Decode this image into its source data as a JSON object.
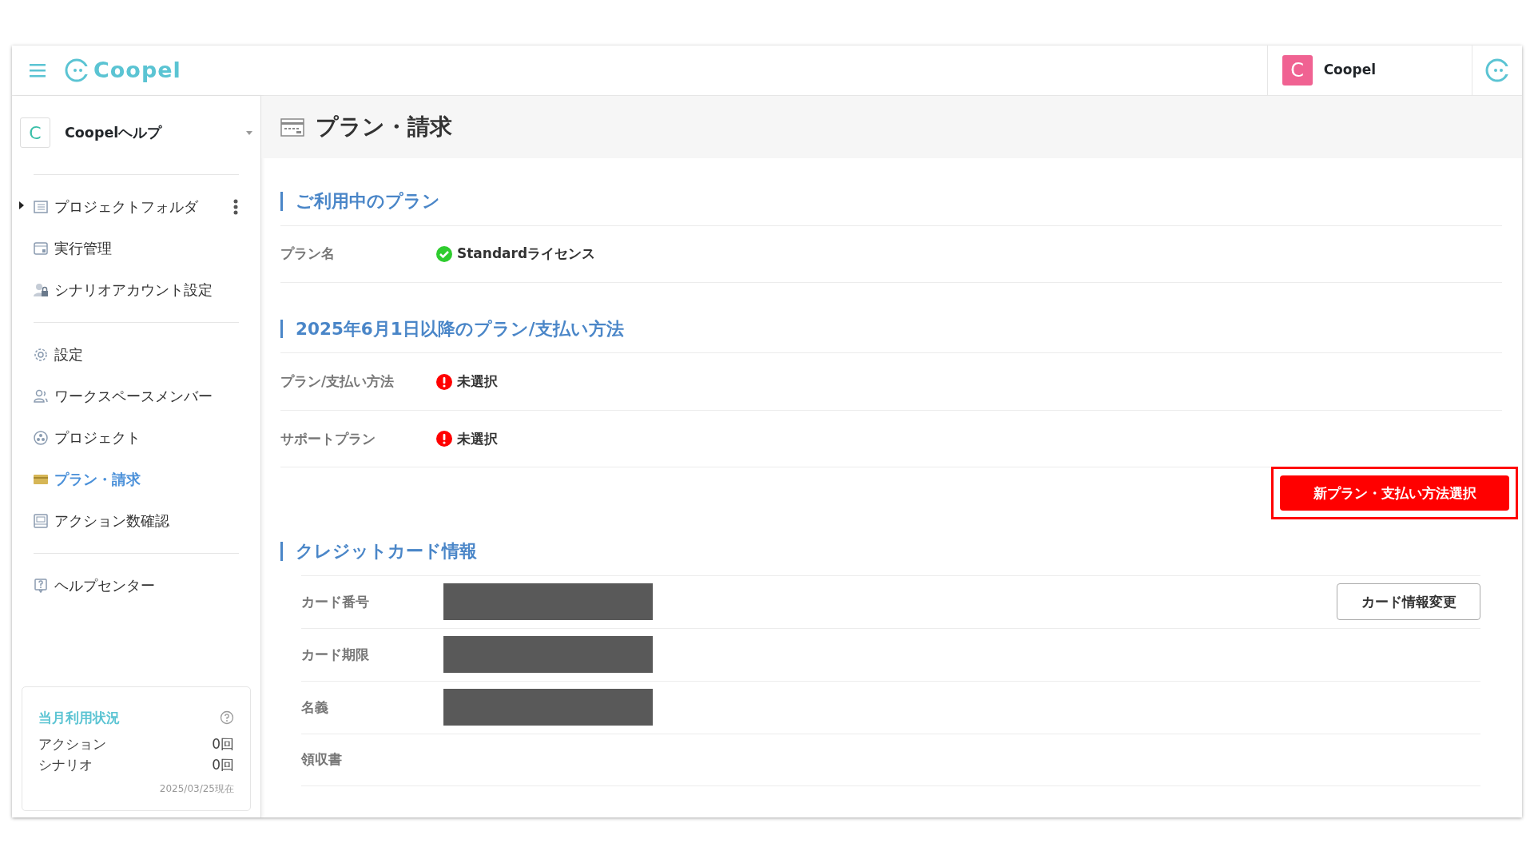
{
  "header": {
    "logo_text": "Coopel",
    "user_initial": "C",
    "user_name": "Coopel"
  },
  "workspace": {
    "initial": "C",
    "name": "Coopelヘルプ"
  },
  "nav_groups": [
    {
      "items": [
        {
          "label": "プロジェクトフォルダ",
          "selected": false,
          "expandable": true
        },
        {
          "label": "実行管理",
          "selected": false,
          "expandable": false
        },
        {
          "label": "シナリオアカウント設定",
          "selected": false,
          "expandable": false
        }
      ]
    },
    {
      "items": [
        {
          "label": "設定",
          "selected": false,
          "expandable": false
        },
        {
          "label": "ワークスペースメンバー",
          "selected": false,
          "expandable": false
        },
        {
          "label": "プロジェクト",
          "selected": false,
          "expandable": false
        },
        {
          "label": "プラン・請求",
          "selected": true,
          "expandable": false
        },
        {
          "label": "アクション数確認",
          "selected": false,
          "expandable": false
        }
      ]
    },
    {
      "items": [
        {
          "label": "ヘルプセンター",
          "selected": false,
          "expandable": false
        }
      ]
    }
  ],
  "usage": {
    "title": "当月利用状況",
    "rows": [
      {
        "label": "アクション",
        "value": "0回"
      },
      {
        "label": "シナリオ",
        "value": "0回"
      }
    ],
    "as_of": "2025/03/25現在"
  },
  "page_title": "プラン・請求",
  "sections": [
    {
      "heading": "ご利用中のプラン",
      "rows": [
        {
          "label": "プラン名",
          "kind": "ok",
          "value": "Standardライセンス"
        }
      ]
    },
    {
      "heading": "2025年6月1日以降のプラン/支払い方法",
      "rows": [
        {
          "label": "プラン/支払い方法",
          "kind": "missing",
          "value": "未選択"
        },
        {
          "label": "サポートプラン",
          "kind": "missing",
          "value": "未選択"
        }
      ],
      "action": {
        "label": "新プラン・支払い方法選択",
        "highlighted": true
      }
    }
  ],
  "card_section": {
    "heading": "クレジットカード情報",
    "change_button": "カード情報変更",
    "rows": [
      {
        "label": "カード番号",
        "masked": true
      },
      {
        "label": "カード期限",
        "masked": true
      },
      {
        "label": "名義",
        "masked": true
      },
      {
        "label": "領収書",
        "masked": false
      }
    ]
  }
}
